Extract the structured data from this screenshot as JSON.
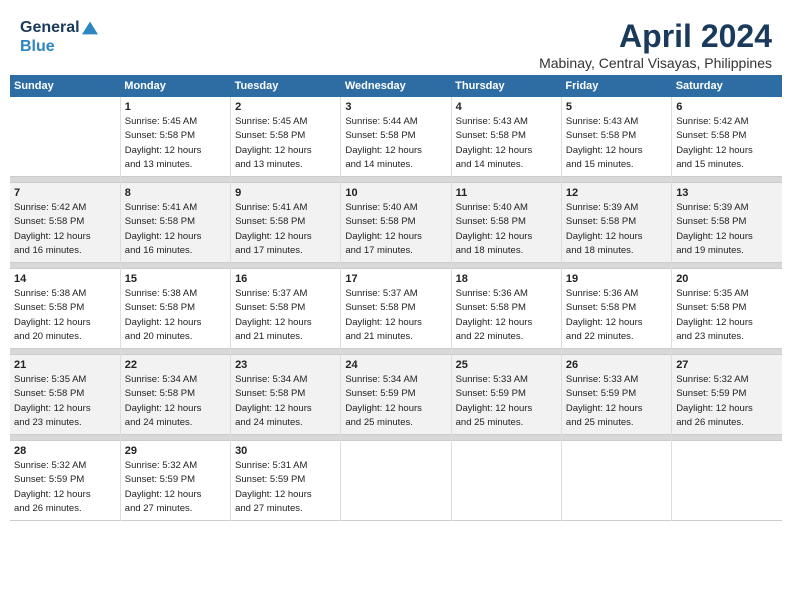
{
  "header": {
    "logo_line1": "General",
    "logo_line2": "Blue",
    "month": "April 2024",
    "location": "Mabinay, Central Visayas, Philippines"
  },
  "days_of_week": [
    "Sunday",
    "Monday",
    "Tuesday",
    "Wednesday",
    "Thursday",
    "Friday",
    "Saturday"
  ],
  "weeks": [
    [
      {
        "day": "",
        "info": ""
      },
      {
        "day": "1",
        "info": "Sunrise: 5:45 AM\nSunset: 5:58 PM\nDaylight: 12 hours\nand 13 minutes."
      },
      {
        "day": "2",
        "info": "Sunrise: 5:45 AM\nSunset: 5:58 PM\nDaylight: 12 hours\nand 13 minutes."
      },
      {
        "day": "3",
        "info": "Sunrise: 5:44 AM\nSunset: 5:58 PM\nDaylight: 12 hours\nand 14 minutes."
      },
      {
        "day": "4",
        "info": "Sunrise: 5:43 AM\nSunset: 5:58 PM\nDaylight: 12 hours\nand 14 minutes."
      },
      {
        "day": "5",
        "info": "Sunrise: 5:43 AM\nSunset: 5:58 PM\nDaylight: 12 hours\nand 15 minutes."
      },
      {
        "day": "6",
        "info": "Sunrise: 5:42 AM\nSunset: 5:58 PM\nDaylight: 12 hours\nand 15 minutes."
      }
    ],
    [
      {
        "day": "7",
        "info": "Sunrise: 5:42 AM\nSunset: 5:58 PM\nDaylight: 12 hours\nand 16 minutes."
      },
      {
        "day": "8",
        "info": "Sunrise: 5:41 AM\nSunset: 5:58 PM\nDaylight: 12 hours\nand 16 minutes."
      },
      {
        "day": "9",
        "info": "Sunrise: 5:41 AM\nSunset: 5:58 PM\nDaylight: 12 hours\nand 17 minutes."
      },
      {
        "day": "10",
        "info": "Sunrise: 5:40 AM\nSunset: 5:58 PM\nDaylight: 12 hours\nand 17 minutes."
      },
      {
        "day": "11",
        "info": "Sunrise: 5:40 AM\nSunset: 5:58 PM\nDaylight: 12 hours\nand 18 minutes."
      },
      {
        "day": "12",
        "info": "Sunrise: 5:39 AM\nSunset: 5:58 PM\nDaylight: 12 hours\nand 18 minutes."
      },
      {
        "day": "13",
        "info": "Sunrise: 5:39 AM\nSunset: 5:58 PM\nDaylight: 12 hours\nand 19 minutes."
      }
    ],
    [
      {
        "day": "14",
        "info": "Sunrise: 5:38 AM\nSunset: 5:58 PM\nDaylight: 12 hours\nand 20 minutes."
      },
      {
        "day": "15",
        "info": "Sunrise: 5:38 AM\nSunset: 5:58 PM\nDaylight: 12 hours\nand 20 minutes."
      },
      {
        "day": "16",
        "info": "Sunrise: 5:37 AM\nSunset: 5:58 PM\nDaylight: 12 hours\nand 21 minutes."
      },
      {
        "day": "17",
        "info": "Sunrise: 5:37 AM\nSunset: 5:58 PM\nDaylight: 12 hours\nand 21 minutes."
      },
      {
        "day": "18",
        "info": "Sunrise: 5:36 AM\nSunset: 5:58 PM\nDaylight: 12 hours\nand 22 minutes."
      },
      {
        "day": "19",
        "info": "Sunrise: 5:36 AM\nSunset: 5:58 PM\nDaylight: 12 hours\nand 22 minutes."
      },
      {
        "day": "20",
        "info": "Sunrise: 5:35 AM\nSunset: 5:58 PM\nDaylight: 12 hours\nand 23 minutes."
      }
    ],
    [
      {
        "day": "21",
        "info": "Sunrise: 5:35 AM\nSunset: 5:58 PM\nDaylight: 12 hours\nand 23 minutes."
      },
      {
        "day": "22",
        "info": "Sunrise: 5:34 AM\nSunset: 5:58 PM\nDaylight: 12 hours\nand 24 minutes."
      },
      {
        "day": "23",
        "info": "Sunrise: 5:34 AM\nSunset: 5:58 PM\nDaylight: 12 hours\nand 24 minutes."
      },
      {
        "day": "24",
        "info": "Sunrise: 5:34 AM\nSunset: 5:59 PM\nDaylight: 12 hours\nand 25 minutes."
      },
      {
        "day": "25",
        "info": "Sunrise: 5:33 AM\nSunset: 5:59 PM\nDaylight: 12 hours\nand 25 minutes."
      },
      {
        "day": "26",
        "info": "Sunrise: 5:33 AM\nSunset: 5:59 PM\nDaylight: 12 hours\nand 25 minutes."
      },
      {
        "day": "27",
        "info": "Sunrise: 5:32 AM\nSunset: 5:59 PM\nDaylight: 12 hours\nand 26 minutes."
      }
    ],
    [
      {
        "day": "28",
        "info": "Sunrise: 5:32 AM\nSunset: 5:59 PM\nDaylight: 12 hours\nand 26 minutes."
      },
      {
        "day": "29",
        "info": "Sunrise: 5:32 AM\nSunset: 5:59 PM\nDaylight: 12 hours\nand 27 minutes."
      },
      {
        "day": "30",
        "info": "Sunrise: 5:31 AM\nSunset: 5:59 PM\nDaylight: 12 hours\nand 27 minutes."
      },
      {
        "day": "",
        "info": ""
      },
      {
        "day": "",
        "info": ""
      },
      {
        "day": "",
        "info": ""
      },
      {
        "day": "",
        "info": ""
      }
    ]
  ]
}
